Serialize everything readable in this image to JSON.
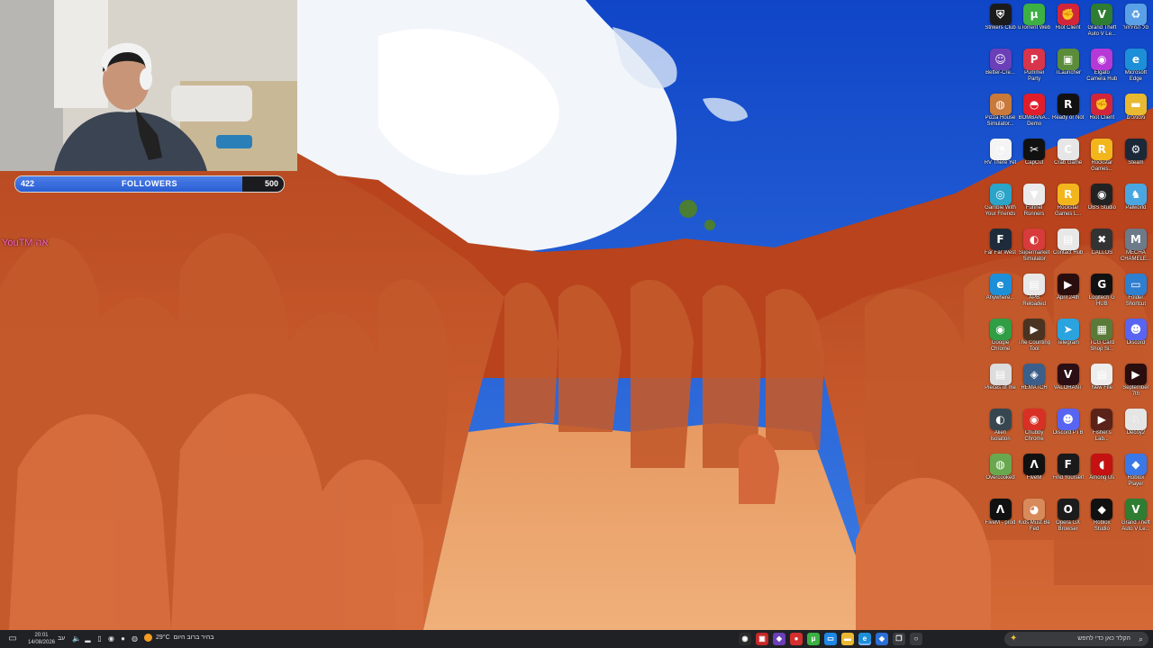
{
  "overlay": {
    "follower_goal": {
      "current": "422",
      "label": "FOLLOWERS",
      "goal": "500",
      "progress_fraction": 0.844
    },
    "chat_tag": "YouTM אה"
  },
  "desktop_icons": [
    {
      "label": "Strikers Club",
      "icon": "shield-icon",
      "color": "#1b1b1b",
      "glyph": "⛨"
    },
    {
      "label": "uTorrent Web",
      "icon": "utorrent-icon",
      "color": "#3cb043",
      "glyph": "μ"
    },
    {
      "label": "Riot Client",
      "icon": "riot-fist-icon",
      "color": "#d3253a",
      "glyph": "✊"
    },
    {
      "label": "Grand Theft Auto V Le...",
      "icon": "gta-icon",
      "color": "#2e7d32",
      "glyph": "V"
    },
    {
      "label": "סל המיחזור",
      "icon": "recycle-bin-icon",
      "color": "#5aa0e6",
      "glyph": "♻"
    },
    {
      "label": "Better-Cre...",
      "icon": "better-crewlink-icon",
      "color": "#6a3fb8",
      "glyph": "☺"
    },
    {
      "label": "Pummel Party",
      "icon": "pummel-party-icon",
      "color": "#d8344a",
      "glyph": "P"
    },
    {
      "label": "TLauncher",
      "icon": "minecraft-block-icon",
      "color": "#5b8c3a",
      "glyph": "▣"
    },
    {
      "label": "Elgato Camera Hub",
      "icon": "camera-hub-icon",
      "color": "#b638d6",
      "glyph": "◉"
    },
    {
      "label": "Microsoft Edge",
      "icon": "edge-icon",
      "color": "#1d8fd8",
      "glyph": "e"
    },
    {
      "label": "Pizza House Simulator...",
      "icon": "pizza-icon",
      "color": "#c9793a",
      "glyph": "◍"
    },
    {
      "label": "BOMBANA... Demo",
      "icon": "lips-icon",
      "color": "#e11d2b",
      "glyph": "◓"
    },
    {
      "label": "Ready or Not",
      "icon": "ron-icon",
      "color": "#111111",
      "glyph": "R"
    },
    {
      "label": "Riot Client",
      "icon": "riot-fist-icon",
      "color": "#d3253a",
      "glyph": "✊"
    },
    {
      "label": "מסמכים",
      "icon": "folder-icon",
      "color": "#e8b931",
      "glyph": "▬"
    },
    {
      "label": "RV There Yet",
      "icon": "rv-icon",
      "color": "#f4f4f4",
      "glyph": "◔"
    },
    {
      "label": "CapCut",
      "icon": "capcut-icon",
      "color": "#111111",
      "glyph": "✂"
    },
    {
      "label": "Crab Game",
      "icon": "crab-game-icon",
      "color": "#e6e6e6",
      "glyph": "C"
    },
    {
      "label": "Rockstar Games...",
      "icon": "rockstar-icon",
      "color": "#f3b51c",
      "glyph": "R"
    },
    {
      "label": "Steam",
      "icon": "steam-icon",
      "color": "#1b2838",
      "glyph": "⚙"
    },
    {
      "label": "Gamble With Your Friends",
      "icon": "gamble-icon",
      "color": "#2aa4c8",
      "glyph": "◎"
    },
    {
      "label": "Funnel Runners",
      "icon": "funnel-icon",
      "color": "#eaeaea",
      "glyph": "▼"
    },
    {
      "label": "Rockstar Games L...",
      "icon": "rockstar-icon",
      "color": "#f3b51c",
      "glyph": "R"
    },
    {
      "label": "OBS Studio",
      "icon": "obs-icon",
      "color": "#222222",
      "glyph": "◉"
    },
    {
      "label": "Palworld",
      "icon": "palworld-icon",
      "color": "#4aa6e0",
      "glyph": "♞"
    },
    {
      "label": "Far Far West",
      "icon": "farwest-icon",
      "color": "#1e2b3a",
      "glyph": "F"
    },
    {
      "label": "Supermarket Simulator",
      "icon": "supermarket-icon",
      "color": "#d73b3b",
      "glyph": "◐"
    },
    {
      "label": "Contact Hub",
      "icon": "document-icon",
      "color": "#e8e8e8",
      "glyph": "▤"
    },
    {
      "label": "CALLOS",
      "icon": "callos-icon",
      "color": "#333333",
      "glyph": "✖"
    },
    {
      "label": "MECHA CHAMELE...",
      "icon": "mecha-icon",
      "color": "#6c7a89",
      "glyph": "M"
    },
    {
      "label": "Anywhere...",
      "icon": "edge-icon",
      "color": "#1d8fd8",
      "glyph": "e"
    },
    {
      "label": "APB Reloaded",
      "icon": "document-icon",
      "color": "#e8e8e8",
      "glyph": "▤"
    },
    {
      "label": "April 24th",
      "icon": "video-file-icon",
      "color": "#2a0e0e",
      "glyph": "▶"
    },
    {
      "label": "Logitech G HUB",
      "icon": "logitech-g-icon",
      "color": "#111111",
      "glyph": "G"
    },
    {
      "label": "Folder Shortcut",
      "icon": "monitor-icon",
      "color": "#2f7fd0",
      "glyph": "▭"
    },
    {
      "label": "Google Chrome",
      "icon": "chrome-icon",
      "color": "#2f9e44",
      "glyph": "◉"
    },
    {
      "label": "The Counting Tool",
      "icon": "video-file-icon",
      "color": "#4a3320",
      "glyph": "▶"
    },
    {
      "label": "Telegram",
      "icon": "telegram-icon",
      "color": "#2aa3df",
      "glyph": "➤"
    },
    {
      "label": "TCG Card Shop Si...",
      "icon": "card-shop-icon",
      "color": "#5a7a3a",
      "glyph": "▦"
    },
    {
      "label": "Discord",
      "icon": "discord-icon",
      "color": "#5865f2",
      "glyph": "☻"
    },
    {
      "label": "Pieces of me",
      "icon": "document-icon",
      "color": "#dcdcdc",
      "glyph": "▤"
    },
    {
      "label": "REMATCH",
      "icon": "rematch-icon",
      "color": "#3b5f8a",
      "glyph": "◈"
    },
    {
      "label": "VALORANT",
      "icon": "valorant-icon",
      "color": "#2b0f14",
      "glyph": "V"
    },
    {
      "label": "New File",
      "icon": "document-icon",
      "color": "#ededed",
      "glyph": "▤"
    },
    {
      "label": "September 7th",
      "icon": "video-file-icon",
      "color": "#2a0e0e",
      "glyph": "▶"
    },
    {
      "label": "Alien Isolation",
      "icon": "alien-icon",
      "color": "#37474f",
      "glyph": "◐"
    },
    {
      "label": "Chubby Chrome",
      "icon": "chrome-icon",
      "color": "#d93025",
      "glyph": "◉"
    },
    {
      "label": "Discord PTB",
      "icon": "discord-icon",
      "color": "#5865f2",
      "glyph": "☻"
    },
    {
      "label": "Fisher's Lab...",
      "icon": "video-file-icon",
      "color": "#5a2218",
      "glyph": "▶"
    },
    {
      "label": "Decoy2",
      "icon": "bunny-icon",
      "color": "#e5e5e5",
      "glyph": "♘"
    },
    {
      "label": "Overcooked",
      "icon": "overcooked-icon",
      "color": "#6aa84f",
      "glyph": "◍"
    },
    {
      "label": "FiveM",
      "icon": "fivem-icon",
      "color": "#111111",
      "glyph": "Λ"
    },
    {
      "label": "Find Yourself",
      "icon": "find-yourself-icon",
      "color": "#1a1a1a",
      "glyph": "F"
    },
    {
      "label": "Among Us",
      "icon": "among-us-icon",
      "color": "#c51111",
      "glyph": "◖"
    },
    {
      "label": "Roblox Player",
      "icon": "roblox-icon",
      "color": "#3a78e8",
      "glyph": "◆"
    },
    {
      "label": "FiveM - prod",
      "icon": "fivem-icon",
      "color": "#111111",
      "glyph": "Λ"
    },
    {
      "label": "Kids Must Be Fed",
      "icon": "kids-icon",
      "color": "#d88a5a",
      "glyph": "◕"
    },
    {
      "label": "Opera GX Browser",
      "icon": "opera-gx-icon",
      "color": "#1c1c1c",
      "glyph": "O"
    },
    {
      "label": "Roblox Studio",
      "icon": "roblox-studio-icon",
      "color": "#111111",
      "glyph": "◆"
    },
    {
      "label": "Grand Theft Auto V Le...",
      "icon": "gta-icon",
      "color": "#2e7d32",
      "glyph": "V"
    }
  ],
  "taskbar": {
    "clock_time": "20:01",
    "clock_date": "14/08/2026",
    "lang": "עב",
    "weather_temp": "29°C",
    "weather_text": "בהיר ברוב היום",
    "search_placeholder": "הקלד כאן כדי לחפש",
    "pinned": [
      {
        "icon": "obs-taskbar-icon",
        "color": "#2b2b2b",
        "glyph": "◉"
      },
      {
        "icon": "red-app-icon",
        "color": "#c62828",
        "glyph": "▣"
      },
      {
        "icon": "purple-app-icon",
        "color": "#6a3fb8",
        "glyph": "◈"
      },
      {
        "icon": "red-circle-icon",
        "color": "#d32f2f",
        "glyph": "●"
      },
      {
        "icon": "utorrent-icon",
        "color": "#3cb043",
        "glyph": "μ"
      },
      {
        "icon": "monitor-icon",
        "color": "#1e88e5",
        "glyph": "▭"
      },
      {
        "icon": "file-explorer-icon",
        "color": "#e8b931",
        "glyph": "▬"
      },
      {
        "icon": "edge-icon",
        "color": "#1d8fd8",
        "glyph": "e"
      },
      {
        "icon": "store-icon",
        "color": "#2a6fd6",
        "glyph": "◆"
      },
      {
        "icon": "task-view-icon",
        "color": "#3a3b3f",
        "glyph": "❐"
      },
      {
        "icon": "cortana-icon",
        "color": "#3a3b3f",
        "glyph": "○"
      }
    ]
  }
}
